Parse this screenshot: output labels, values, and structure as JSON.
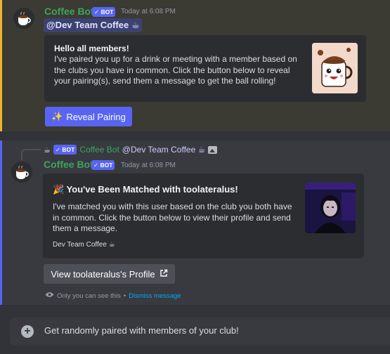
{
  "messages": [
    {
      "author": "Coffee Bot",
      "bot_tag": "✓ BOT",
      "timestamp": "Today at 6:08 PM",
      "mention": "@Dev Team Coffee",
      "embed": {
        "title": "Hello all members!",
        "description": "I've paired you up for a drink or meeting with a member based on the clubs you have in common. Click the button below to reveal your pairing(s), send them a message to get the ball rolling!"
      },
      "button": {
        "emoji": "✨",
        "label": "Reveal Pairing"
      }
    },
    {
      "reply": {
        "bot_tag": "✓ BOT",
        "author": "Coffee Bot",
        "mention": "@Dev Team Coffee"
      },
      "author": "Coffee Bot",
      "bot_tag": "✓ BOT",
      "timestamp": "Today at 6:08 PM",
      "embed": {
        "title_emoji": "🎉",
        "title": "You've Been Matched with toolateralus!",
        "description": "I've matched you with this user based on the club you both have in common. Click the button below to view their profile and send them a message.",
        "footer": "Dev Team Coffee"
      },
      "button": {
        "label": "View toolateralus's Profile"
      },
      "ephemeral": {
        "text": "Only you can see this",
        "separator": " • ",
        "link": "Dismiss message"
      }
    }
  ],
  "composer": {
    "placeholder": "Get randomly paired with members of your club!"
  },
  "icons": {
    "coffee": "coffee-cup-icon",
    "external_link": "external-link-icon",
    "eye": "eye-icon",
    "plus": "plus-circle-icon",
    "image": "image-icon"
  },
  "colors": {
    "bot_name": "#3ba55d",
    "blurple": "#5865f2",
    "highlight_border": "#f0b232",
    "link": "#00a8fc"
  }
}
